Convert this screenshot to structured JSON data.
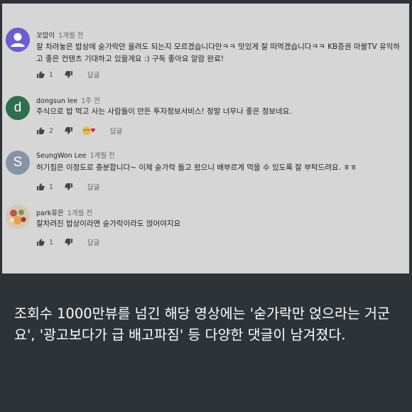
{
  "comments": [
    {
      "author": "꼬맙이",
      "time": "1개월 전",
      "avatar_color": "#6a5ed0",
      "text": "잘 차려놓은 밥상에 숟가락만 올려도 되는지 모르겠습니다만ㅋㅋ 맛있게 잘 떠먹겠습니다ㅋㅋ KB증권 마블TV 유익하고 좋은 컨텐츠 기대하고 있을게요 :) 구독 좋아요 알람 완료!",
      "likes": "1",
      "reply_label": "답글"
    },
    {
      "author": "dongsun lee",
      "time": "1주 전",
      "avatar_letter": "d",
      "avatar_color": "#2f6f4d",
      "text": "주식으로 밥 먹고 사는 사람들이 만든 투자정보서비스! 정말 너무나 좋은 정보네요.",
      "likes": "2",
      "reply_label": "답글"
    },
    {
      "author": "SeungWon Lee",
      "time": "1개월 전",
      "avatar_letter": "S",
      "avatar_color": "#8793a6",
      "text": "허기짐은 이정도로 충분합니다~ 이제 숟가락 들고 왔으니 배부르게 먹을 수 있도록 잘 부탁드려요. ㅎㅎ",
      "likes": "1",
      "reply_label": "답글"
    },
    {
      "author": "park유은",
      "time": "1개월 전",
      "avatar_color": "#c9b9a8",
      "text": "잘차려진 밥상이라면 숟가락이라도 얹어야지요",
      "likes": "1",
      "reply_label": "답글"
    }
  ],
  "caption": "조회수 1000만뷰를 넘긴 해당 영상에는 '숟가락만 얹으라는 거군요', '광고보다가 급 배고파짐' 등 다양한 댓글이 남겨졌다.",
  "colors": {
    "caption_bg": "#2e3338",
    "page_bg": "#d6d6d6"
  }
}
